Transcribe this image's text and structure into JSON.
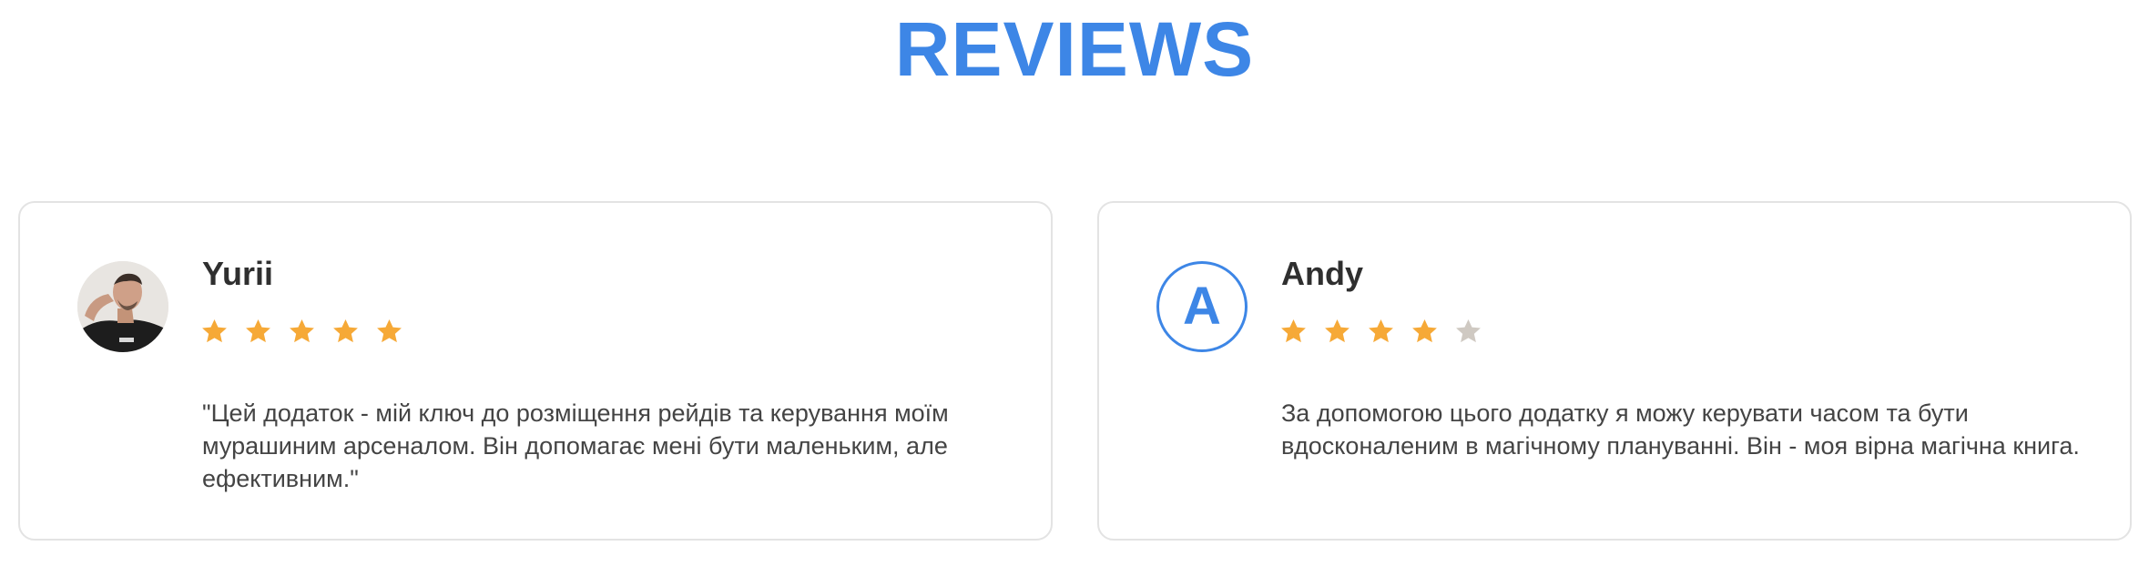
{
  "heading": "REVIEWS",
  "colors": {
    "accent": "#3d86e6",
    "star_filled": "#f6a937",
    "star_empty": "#cfc9c2",
    "card_border": "#e3e3e3",
    "text": "#444444"
  },
  "reviews": [
    {
      "name": "Yurii",
      "avatar_type": "photo",
      "rating": 5,
      "max_rating": 5,
      "text": "\"Цей додаток - мій ключ до розміщення рейдів та керування моїм мурашиним арсеналом. Він допомагає мені бути маленьким, але ефективним.\""
    },
    {
      "name": "Andy",
      "avatar_type": "letter",
      "avatar_letter": "A",
      "rating": 4,
      "max_rating": 5,
      "text": "За допомогою цього додатку я можу керувати часом та бути вдосконаленим в магічному плануванні. Він - моя вірна магічна книга."
    }
  ]
}
